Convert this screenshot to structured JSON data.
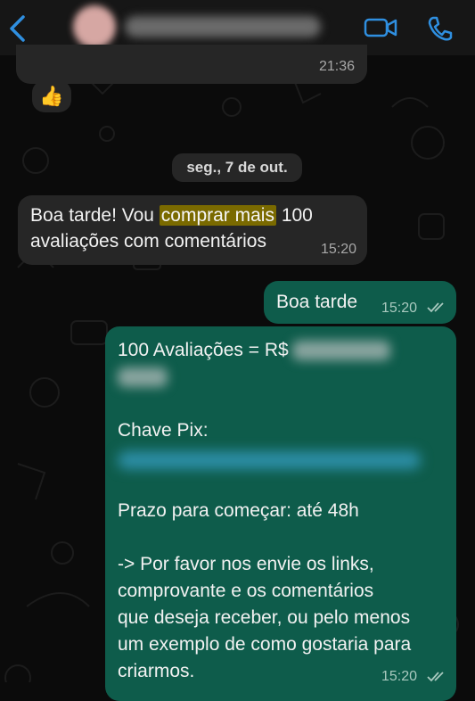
{
  "header": {
    "back_icon": "chevron-left-icon",
    "video_icon": "video-call-icon",
    "phone_icon": "phone-icon",
    "accent": "#2f8fe0"
  },
  "messages": {
    "prev_time": "21:36",
    "thumbs_emoji": "👍",
    "date_divider": "seg., 7 de out.",
    "msg1": {
      "pre": "Boa tarde! Vou ",
      "highlight": "comprar mais",
      "post": " 100",
      "line2": "avaliações com comentários",
      "time": "15:20"
    },
    "msg2": {
      "text": "Boa tarde",
      "time": "15:20"
    },
    "msg3": {
      "price_label": "100 Avaliações  = R$",
      "pix_label": "Chave Pix:",
      "deadline": "Prazo para começar: até 48h",
      "line1": "-> Por favor nos envie os links,",
      "line2": "comprovante e os comentários",
      "line3": "que deseja receber, ou pelo menos",
      "line4": "um exemplo de como gostaria para",
      "line5": "criarmos.",
      "time": "15:20"
    }
  },
  "colors": {
    "incoming_bubble": "#262626",
    "outgoing_bubble": "#0e5c4b",
    "highlight": "#7a6a00"
  }
}
